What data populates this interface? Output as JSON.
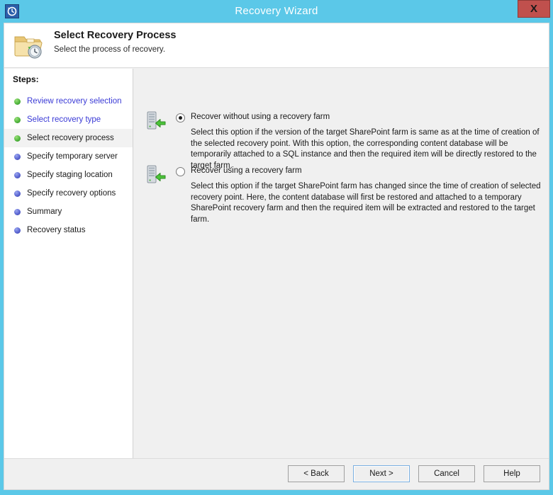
{
  "window": {
    "title": "Recovery Wizard",
    "title_icon": "recovery-clock-icon",
    "close_label": "X",
    "titlebar_color": "#5bc8e8",
    "close_color": "#c0504d"
  },
  "header": {
    "icon": "folder-clock-icon",
    "title": "Select Recovery Process",
    "subtitle": "Select the process of recovery."
  },
  "sidebar": {
    "heading": "Steps:",
    "items": [
      {
        "label": "Review recovery selection",
        "state": "done",
        "style": "link"
      },
      {
        "label": "Select recovery type",
        "state": "done",
        "style": "link"
      },
      {
        "label": "Select recovery process",
        "state": "done",
        "style": "current"
      },
      {
        "label": "Specify temporary server",
        "state": "todo",
        "style": "plain"
      },
      {
        "label": "Specify staging location",
        "state": "todo",
        "style": "plain"
      },
      {
        "label": "Specify recovery options",
        "state": "todo",
        "style": "plain"
      },
      {
        "label": "Summary",
        "state": "todo",
        "style": "plain"
      },
      {
        "label": "Recovery status",
        "state": "todo",
        "style": "plain"
      }
    ],
    "bullet_done_color": "#4cb33a",
    "bullet_todo_color": "#5661cf",
    "link_color": "#3a3ad6"
  },
  "main": {
    "options": [
      {
        "icon": "server-restore-icon",
        "label": "Recover without using a recovery farm",
        "selected": true,
        "description": "Select this option if the version of the target SharePoint farm is same as at the time of creation of the selected recovery point. With this option, the corresponding content database will be temporarily attached to a SQL instance and then the required item will be directly restored to the target farm."
      },
      {
        "icon": "server-restore-icon",
        "label": "Recover using a recovery farm",
        "selected": false,
        "description": "Select this option if the target SharePoint farm has changed since the time of creation of selected recovery point. Here, the content database will first be restored and attached to a temporary SharePoint recovery farm and then the required item will be extracted and restored to the target farm."
      }
    ]
  },
  "footer": {
    "buttons": [
      {
        "label": "< Back",
        "focused": false
      },
      {
        "label": "Next >",
        "focused": true
      },
      {
        "label": "Cancel",
        "focused": false
      },
      {
        "label": "Help",
        "focused": false
      }
    ]
  }
}
